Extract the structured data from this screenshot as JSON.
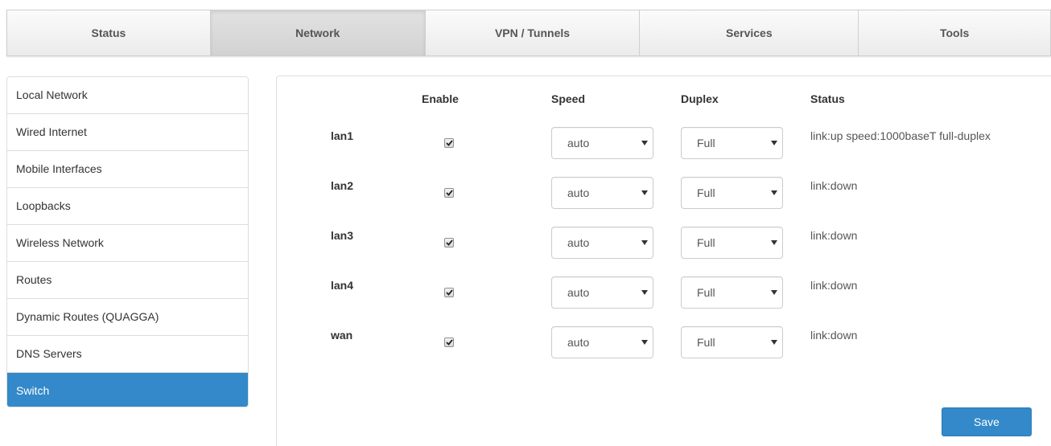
{
  "topnav": {
    "tabs": [
      {
        "label": "Status"
      },
      {
        "label": "Network"
      },
      {
        "label": "VPN / Tunnels"
      },
      {
        "label": "Services"
      },
      {
        "label": "Tools"
      }
    ],
    "active": "Network"
  },
  "sidebar": {
    "items": [
      {
        "label": "Local Network"
      },
      {
        "label": "Wired Internet"
      },
      {
        "label": "Mobile Interfaces"
      },
      {
        "label": "Loopbacks"
      },
      {
        "label": "Wireless Network"
      },
      {
        "label": "Routes"
      },
      {
        "label": "Dynamic Routes (QUAGGA)"
      },
      {
        "label": "DNS Servers"
      },
      {
        "label": "Switch"
      }
    ],
    "active": "Switch"
  },
  "table": {
    "headers": {
      "enable": "Enable",
      "speed": "Speed",
      "duplex": "Duplex",
      "status": "Status"
    },
    "rows": [
      {
        "port": "lan1",
        "enabled": true,
        "speed": "auto",
        "duplex": "Full",
        "status": "link:up speed:1000baseT full-duplex"
      },
      {
        "port": "lan2",
        "enabled": true,
        "speed": "auto",
        "duplex": "Full",
        "status": "link:down"
      },
      {
        "port": "lan3",
        "enabled": true,
        "speed": "auto",
        "duplex": "Full",
        "status": "link:down"
      },
      {
        "port": "lan4",
        "enabled": true,
        "speed": "auto",
        "duplex": "Full",
        "status": "link:down"
      },
      {
        "port": "wan",
        "enabled": true,
        "speed": "auto",
        "duplex": "Full",
        "status": "link:down"
      }
    ]
  },
  "actions": {
    "save_label": "Save"
  },
  "colors": {
    "accent": "#3389c9"
  }
}
